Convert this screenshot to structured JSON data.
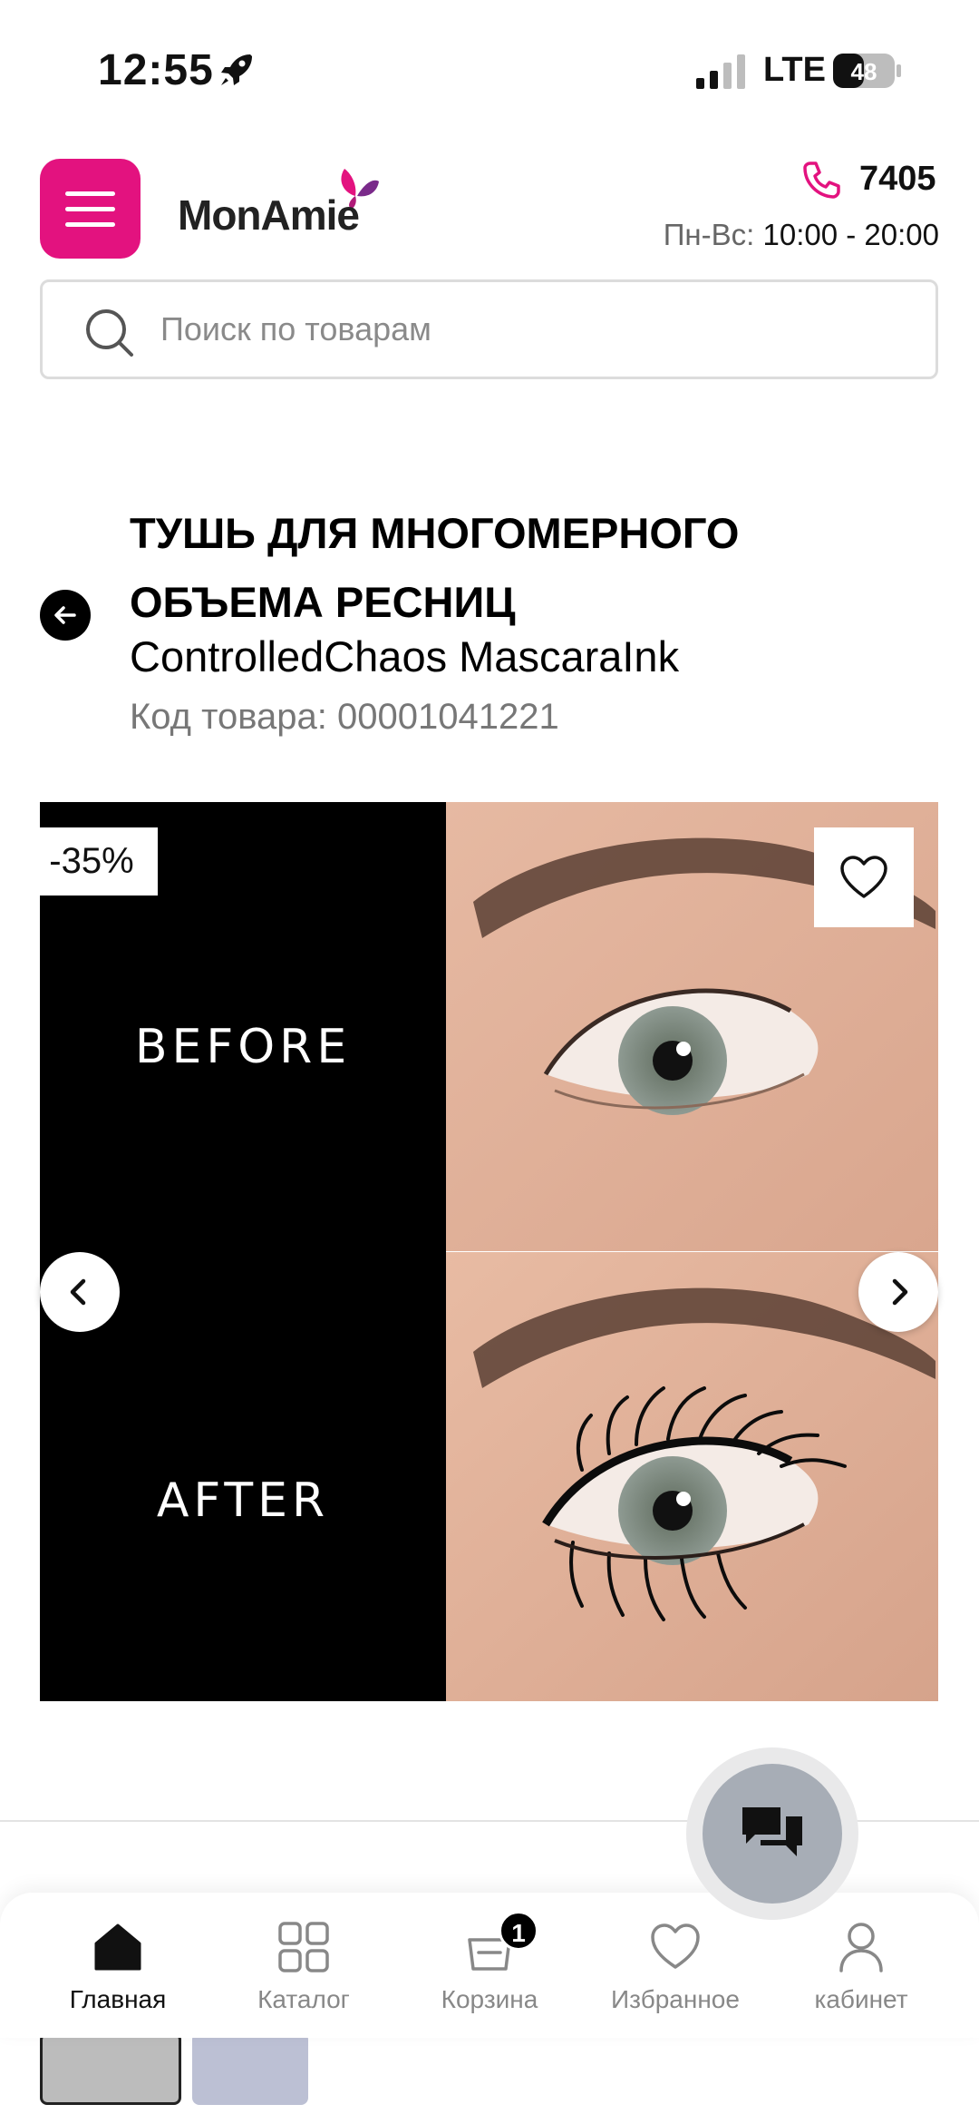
{
  "status_bar": {
    "time": "12:55",
    "network": "LTE",
    "battery": "48"
  },
  "header": {
    "logo_text": "MonAmie",
    "phone": "7405",
    "hours_label": "Пн-Вс:",
    "hours_value": "10:00 - 20:00"
  },
  "search": {
    "placeholder": "Поиск по товарам"
  },
  "product": {
    "title": "ТУШЬ ДЛЯ МНОГОМЕРНОГО ОБЪЕМА РЕСНИЦ",
    "subtitle": "ControlledChaos MascaraInk",
    "sku": "Код товара: 00001041221",
    "discount": "-35%",
    "image_before_label": "BEFORE",
    "image_after_label": "AFTER"
  },
  "tabbar": {
    "items": [
      {
        "label": "Главная",
        "icon": "home-icon",
        "active": true
      },
      {
        "label": "Каталог",
        "icon": "catalog-grid-icon",
        "active": false
      },
      {
        "label": "Корзина",
        "icon": "cart-icon",
        "active": false,
        "badge": "1"
      },
      {
        "label": "Избранное",
        "icon": "heart-icon",
        "active": false
      },
      {
        "label": "кабинет",
        "icon": "user-icon",
        "active": false
      }
    ]
  },
  "colors": {
    "brand_pink": "#e3127f",
    "chat_button": "#a7adb6",
    "swatches": [
      "#bcbcbc",
      "#bcc0d4"
    ]
  }
}
